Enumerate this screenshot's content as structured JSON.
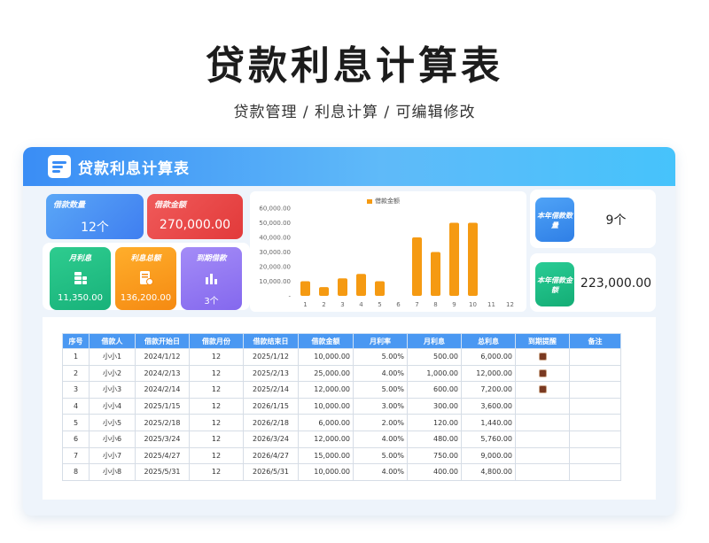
{
  "page": {
    "title": "贷款利息计算表",
    "subtitle": "贷款管理 /  利息计算 /  可编辑修改"
  },
  "header": {
    "title": "贷款利息计算表",
    "icon": "notepad-icon"
  },
  "kpis": {
    "count": {
      "label": "借款数量",
      "value": "12个"
    },
    "amount": {
      "label": "借款金额",
      "value": "270,000.00"
    },
    "monthly_interest": {
      "label": "月利息",
      "value": "11,350.00",
      "icon": "coins-icon"
    },
    "total_interest": {
      "label": "利息总额",
      "value": "136,200.00",
      "icon": "invoice-icon"
    },
    "due": {
      "label": "到期借款",
      "value": "3个",
      "icon": "bar-chart-icon"
    }
  },
  "right_panels": [
    {
      "label": "本年借款数量",
      "value": "9个"
    },
    {
      "label": "本年借款金额",
      "value": "223,000.00"
    }
  ],
  "chart_data": {
    "type": "bar",
    "categories": [
      "1",
      "2",
      "3",
      "4",
      "5",
      "6",
      "7",
      "8",
      "9",
      "10",
      "11",
      "12"
    ],
    "series": [
      {
        "name": "借款金额",
        "values": [
          10000,
          6000,
          12000,
          15000,
          10000,
          0,
          40000,
          30000,
          50000,
          50000,
          0,
          0
        ]
      }
    ],
    "ylim": [
      0,
      60000
    ],
    "yticks": [
      "60,000.00",
      "50,000.00",
      "40,000.00",
      "30,000.00",
      "20,000.00",
      "10,000.00",
      "-"
    ],
    "legend_position": "top",
    "color": "#f59a12"
  },
  "table": {
    "headers": [
      "序号",
      "借款人",
      "借款开始日",
      "借款月份",
      "借款结束日",
      "借款金额",
      "月利率",
      "月利息",
      "总利息",
      "到期提醒",
      "备注"
    ],
    "rows": [
      {
        "no": "1",
        "borrower": "小小1",
        "start": "2024/1/12",
        "months": "12",
        "end": "2025/1/12",
        "amount": "10,000.00",
        "rate": "5.00%",
        "monthly": "500.00",
        "total": "6,000.00",
        "alert": true,
        "note": ""
      },
      {
        "no": "2",
        "borrower": "小小2",
        "start": "2024/2/13",
        "months": "12",
        "end": "2025/2/13",
        "amount": "25,000.00",
        "rate": "4.00%",
        "monthly": "1,000.00",
        "total": "12,000.00",
        "alert": true,
        "note": ""
      },
      {
        "no": "3",
        "borrower": "小小3",
        "start": "2024/2/14",
        "months": "12",
        "end": "2025/2/14",
        "amount": "12,000.00",
        "rate": "5.00%",
        "monthly": "600.00",
        "total": "7,200.00",
        "alert": true,
        "note": ""
      },
      {
        "no": "4",
        "borrower": "小小4",
        "start": "2025/1/15",
        "months": "12",
        "end": "2026/1/15",
        "amount": "10,000.00",
        "rate": "3.00%",
        "monthly": "300.00",
        "total": "3,600.00",
        "alert": false,
        "note": ""
      },
      {
        "no": "5",
        "borrower": "小小5",
        "start": "2025/2/18",
        "months": "12",
        "end": "2026/2/18",
        "amount": "6,000.00",
        "rate": "2.00%",
        "monthly": "120.00",
        "total": "1,440.00",
        "alert": false,
        "note": ""
      },
      {
        "no": "6",
        "borrower": "小小6",
        "start": "2025/3/24",
        "months": "12",
        "end": "2026/3/24",
        "amount": "12,000.00",
        "rate": "4.00%",
        "monthly": "480.00",
        "total": "5,760.00",
        "alert": false,
        "note": ""
      },
      {
        "no": "7",
        "borrower": "小小7",
        "start": "2025/4/27",
        "months": "12",
        "end": "2026/4/27",
        "amount": "15,000.00",
        "rate": "5.00%",
        "monthly": "750.00",
        "total": "9,000.00",
        "alert": false,
        "note": ""
      },
      {
        "no": "8",
        "borrower": "小小8",
        "start": "2025/5/31",
        "months": "12",
        "end": "2026/5/31",
        "amount": "10,000.00",
        "rate": "4.00%",
        "monthly": "400.00",
        "total": "4,800.00",
        "alert": false,
        "note": ""
      }
    ]
  },
  "colors": {
    "accent": "#4a98f2",
    "bar": "#f59a12",
    "alert_flag": "#7a3a22"
  }
}
